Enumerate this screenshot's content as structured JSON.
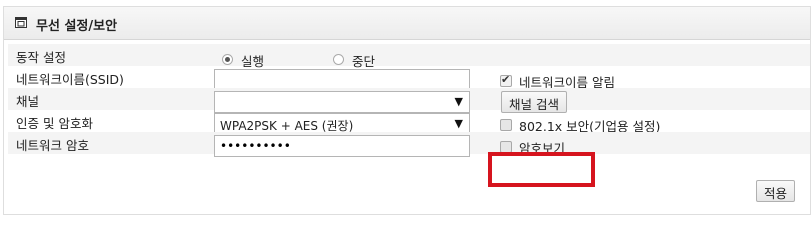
{
  "section": {
    "title": "무선 설정/보안",
    "icon": "copy-window-icon"
  },
  "rows": {
    "operation": {
      "label": "동작 설정",
      "options": [
        {
          "label": "실행",
          "selected": true
        },
        {
          "label": "중단",
          "selected": false
        }
      ]
    },
    "ssid": {
      "label": "네트워크이름(SSID)",
      "value": "",
      "broadcast_label": "네트워크이름 알림",
      "broadcast_checked": true
    },
    "channel": {
      "label": "채널",
      "selected": "",
      "search_button": "채널 검색"
    },
    "auth": {
      "label": "인증 및 암호화",
      "selected": "WPA2PSK + AES (권장)",
      "enterprise_label": "802.1x 보안(기업용 설정)",
      "enterprise_checked": false
    },
    "password": {
      "label": "네트워크 암호",
      "value": "••••••••••",
      "show_label": "암호보기",
      "show_checked": false
    }
  },
  "apply_button": "적용",
  "colors": {
    "highlight": "#d6141e",
    "header_bg": "#ececec"
  }
}
